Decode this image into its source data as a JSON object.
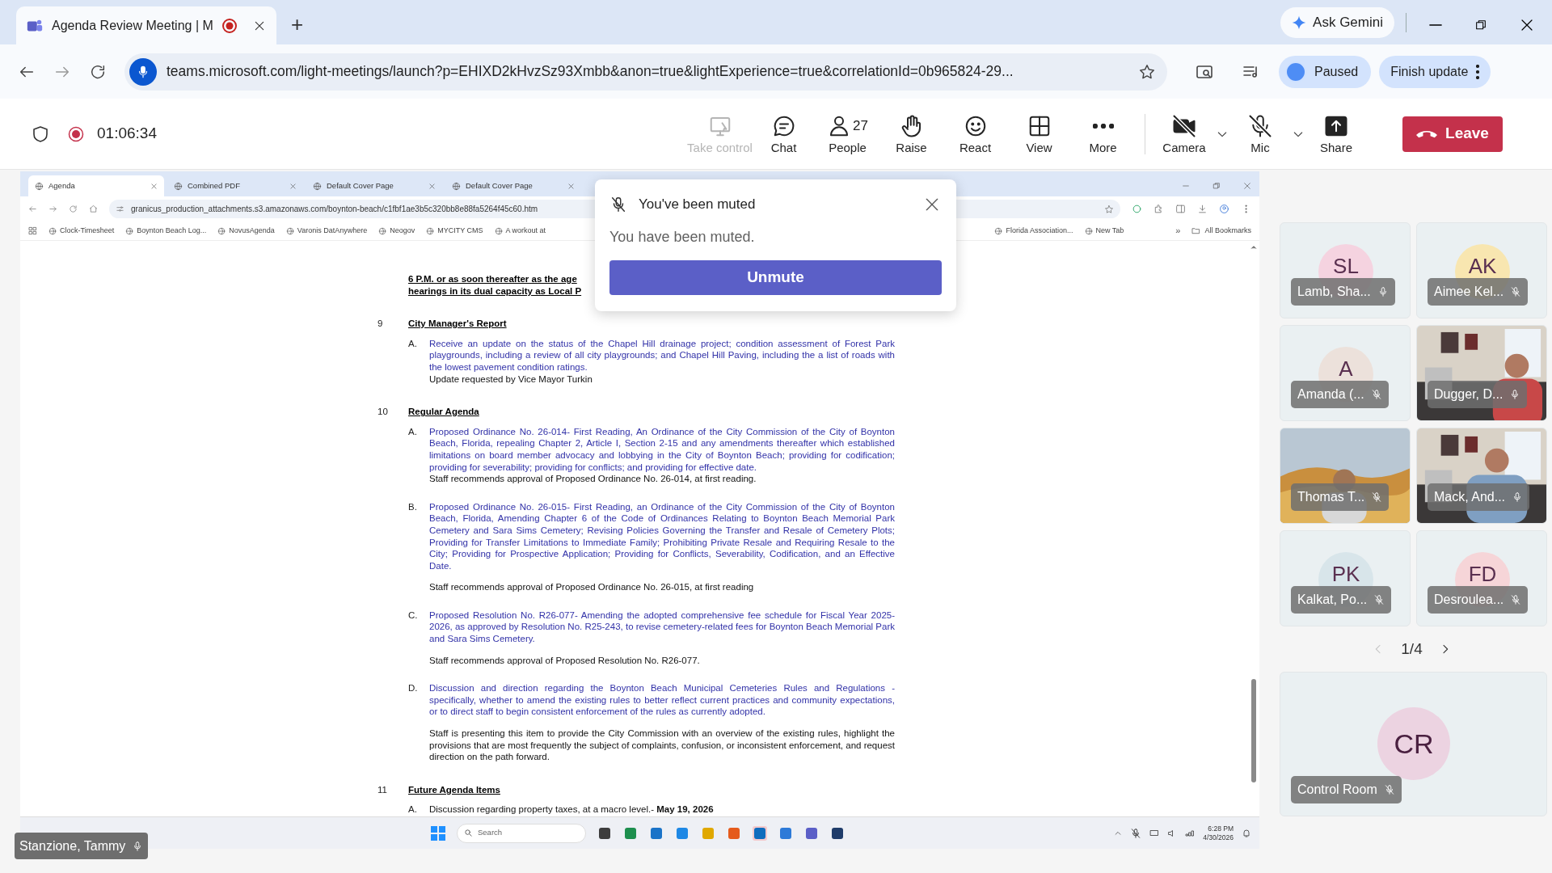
{
  "browser": {
    "tabs": [
      {
        "title": "Agenda Review Meeting | M",
        "recording": true,
        "selected": true
      }
    ],
    "new_tab": "+",
    "url": "teams.microsoft.com/light-meetings/launch?p=EHIXD2kHvzSz93Xmbb&anon=true&lightExperience=true&correlationId=0b965824-29...",
    "gemini": "Ask Gemini",
    "profile": "Paused",
    "update": "Finish update"
  },
  "meeting_bar": {
    "timer": "01:06:34",
    "recording": true,
    "buttons": [
      {
        "kind": "take-control",
        "label": "Take control",
        "disabled": true,
        "off": false,
        "dropdown": false
      },
      {
        "kind": "chat",
        "label": "Chat",
        "disabled": false,
        "off": false,
        "dropdown": false
      },
      {
        "kind": "people",
        "label": "People",
        "count": "27",
        "disabled": false,
        "off": false,
        "dropdown": false
      },
      {
        "kind": "raise",
        "label": "Raise",
        "disabled": false,
        "off": false,
        "dropdown": false
      },
      {
        "kind": "react",
        "label": "React",
        "disabled": false,
        "off": false,
        "dropdown": false
      },
      {
        "kind": "view",
        "label": "View",
        "disabled": false,
        "off": false,
        "dropdown": false
      },
      {
        "kind": "more",
        "label": "More",
        "disabled": false,
        "off": false,
        "dropdown": false
      }
    ],
    "devices": [
      {
        "kind": "camera",
        "label": "Camera",
        "disabled": false,
        "off": true,
        "dropdown": true
      },
      {
        "kind": "mic",
        "label": "Mic",
        "disabled": false,
        "off": true,
        "dropdown": true
      },
      {
        "kind": "share",
        "label": "Share",
        "disabled": false,
        "off": false,
        "dropdown": false
      }
    ],
    "leave": "Leave"
  },
  "shared_screen": {
    "tabs": [
      {
        "title": "Agenda",
        "selected": true
      },
      {
        "title": "Combined PDF",
        "selected": false
      },
      {
        "title": "Default Cover Page",
        "selected": false
      },
      {
        "title": "Default Cover Page",
        "selected": false
      }
    ],
    "url": "granicus_production_attachments.s3.amazonaws.com/boynton-beach/c1fbf1ae3b5c320bb8e88fa5264f45c60.htm",
    "bookmarks": [
      "Clock-Timesheet",
      "Boynton Beach Log...",
      "NovusAgenda",
      "Varonis DatAnywhere",
      "Neogov",
      "MYCITY CMS",
      "A workout at"
    ],
    "bookmarks_right": [
      "Florida Association...",
      "New Tab"
    ],
    "more_bookmarks": "»",
    "all_bookmarks": "All Bookmarks",
    "document": {
      "cut_heading": [
        "6 P.M. or as soon thereafter as the age",
        "hearings in its dual capacity as Local P"
      ],
      "sections": [
        {
          "number": "9",
          "title": "City Manager's Report",
          "items": [
            {
              "letter": "A.",
              "linked": true,
              "text": "Receive an update on the status of the Chapel Hill drainage project; condition assessment of Forest Park playgrounds, including a review of all city playgrounds; and Chapel Hill Paving, including the a list of roads with the lowest pavement condition ratings.",
              "note": "Update requested by Vice Mayor Turkin"
            }
          ]
        },
        {
          "number": "10",
          "title": "Regular Agenda",
          "items": [
            {
              "letter": "A.",
              "linked": true,
              "text": "Proposed Ordinance No. 26-014- First Reading, An Ordinance of the City Commission of the City of Boynton Beach, Florida, repealing Chapter 2, Article I, Section 2-15 and any amendments thereafter which established limitations on board member advocacy and lobbying in the City of Boynton Beach; providing for codification; providing for severability; providing for conflicts; and providing for effective date.",
              "note": "Staff recommends approval of Proposed Ordinance No. 26-014, at first reading."
            },
            {
              "letter": "B.",
              "linked": true,
              "text": "Proposed Ordinance No. 26-015- First Reading, an Ordinance of the City Commission of the City of Boynton Beach, Florida, Amending Chapter 6 of the Code of Ordinances Relating to Boynton Beach Memorial Park Cemetery and Sara Sims Cemetery; Revising Policies Governing the Transfer and Resale of Cemetery Plots; Providing for Transfer Limitations to Immediate Family; Prohibiting Private Resale and Requiring Resale to the City; Providing for Prospective Application; Providing for Conflicts, Severability, Codification, and an Effective Date.",
              "note": "Staff recommends approval of Proposed Ordinance No. 26-015, at first reading"
            },
            {
              "letter": "C.",
              "linked": true,
              "text": "Proposed Resolution No. R26-077- Amending the adopted comprehensive fee schedule for Fiscal Year 2025-2026, as approved by Resolution No. R25-243, to revise cemetery-related fees for Boynton Beach Memorial Park and Sara Sims Cemetery.",
              "note": "Staff recommends approval of Proposed Resolution No. R26-077."
            },
            {
              "letter": "D.",
              "linked": true,
              "text": "Discussion and direction regarding the Boynton Beach Municipal Cemeteries Rules and Regulations - specifically, whether to amend the existing rules to better reflect current practices and community expectations, or to direct staff to begin consistent enforcement of the rules as currently adopted.",
              "note": "Staff is presenting this item to provide the City Commission with an overview of the existing rules, highlight the provisions that are most frequently the subject of complaints, confusion, or inconsistent enforcement, and request direction on the path forward."
            }
          ]
        },
        {
          "number": "11",
          "title": "Future Agenda Items",
          "items": [
            {
              "letter": "A.",
              "linked": false,
              "text": "Discussion regarding property taxes, at a macro level.- **May 19, 2026**"
            }
          ]
        }
      ]
    },
    "taskbar": {
      "search": "Search",
      "time": "6:28 PM",
      "date": "4/30/2026"
    }
  },
  "toast": {
    "title": "You've been muted",
    "message": "You have been muted.",
    "button": "Unmute"
  },
  "participants": [
    {
      "kind": "avatar",
      "name": "Lamb, Sha...",
      "initials": "SL",
      "color": "#f5d3e0",
      "muted": false
    },
    {
      "kind": "avatar",
      "name": "Aimee Kel...",
      "initials": "AK",
      "color": "#f8e6b0",
      "muted": true
    },
    {
      "kind": "avatar",
      "name": "Amanda (...",
      "initials": "A",
      "color": "#ece1db",
      "muted": true
    },
    {
      "kind": "video",
      "name": "Dugger, D...",
      "muted": false
    },
    {
      "kind": "video",
      "name": "Thomas T...",
      "muted": true
    },
    {
      "kind": "video",
      "name": "Mack, And...",
      "muted": false
    },
    {
      "kind": "avatar",
      "name": "Kalkat, Po...",
      "initials": "PK",
      "color": "#d8e5ea",
      "muted": true
    },
    {
      "kind": "avatar",
      "name": "Desroulea...",
      "initials": "FD",
      "color": "#f6d5d8",
      "muted": true
    }
  ],
  "pager": "1/4",
  "spotlight": {
    "name": "Control Room",
    "initials": "CR",
    "color": "#ecd3e1",
    "muted": true
  },
  "presenter": {
    "name": "Stanzione, Tammy",
    "muted": false
  }
}
